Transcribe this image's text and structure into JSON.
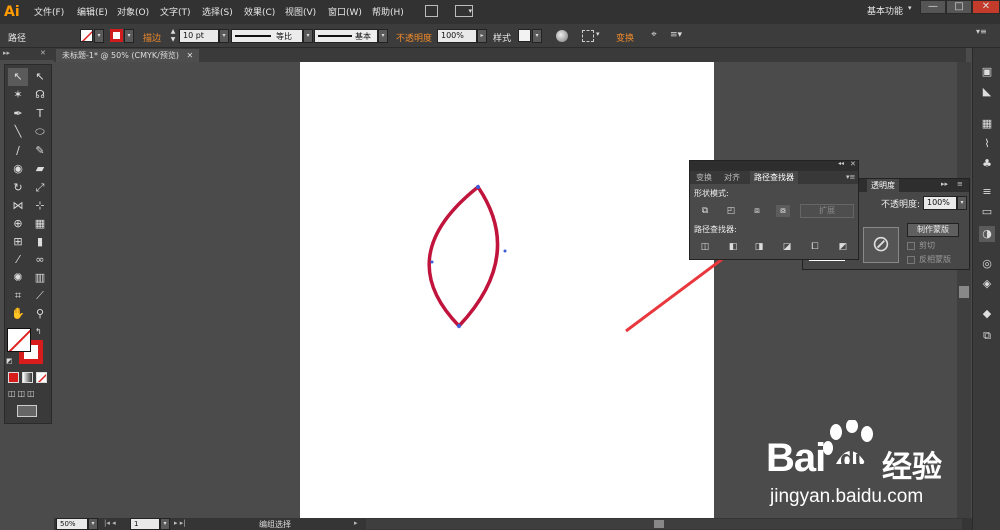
{
  "app": {
    "logo": "Ai",
    "workspace": "基本功能"
  },
  "menu": [
    "文件(F)",
    "编辑(E)",
    "对象(O)",
    "文字(T)",
    "选择(S)",
    "效果(C)",
    "视图(V)",
    "窗口(W)",
    "帮助(H)"
  ],
  "window_controls": {
    "minimize": "—",
    "maximize": "□",
    "close": "✕"
  },
  "control_bar": {
    "object_type": "路径",
    "stroke_label": "描边",
    "stroke_weight": "10 pt",
    "profile_label": "等比",
    "brush_label": "基本",
    "opacity_label": "不透明度",
    "opacity_value": "100%",
    "style_label": "样式",
    "transform_label": "变换"
  },
  "document": {
    "tab_title": "未标题-1* @ 50% (CMYK/预览)",
    "close": "✕"
  },
  "pathfinder_panel": {
    "tabs": [
      "变换",
      "对齐",
      "路径查找器"
    ],
    "shape_modes_label": "形状模式:",
    "expand_button": "扩展",
    "pathfinders_label": "路径查找器:"
  },
  "transparency_panel": {
    "tab": "透明度",
    "opacity_label": "不透明度:",
    "opacity_value": "100%",
    "make_mask_button": "制作蒙版",
    "clip_label": "剪切",
    "invert_label": "反相蒙版"
  },
  "status_bar": {
    "zoom": "50%",
    "page": "1",
    "tool": "编组选择"
  },
  "watermark": {
    "brand": "Bai",
    "brand2": "du",
    "cn": "经验",
    "url": "jingyan.baidu.com"
  },
  "colors": {
    "stroke": "#c0143c",
    "arrow": "#e8383d",
    "accent": "#f08a2a"
  }
}
